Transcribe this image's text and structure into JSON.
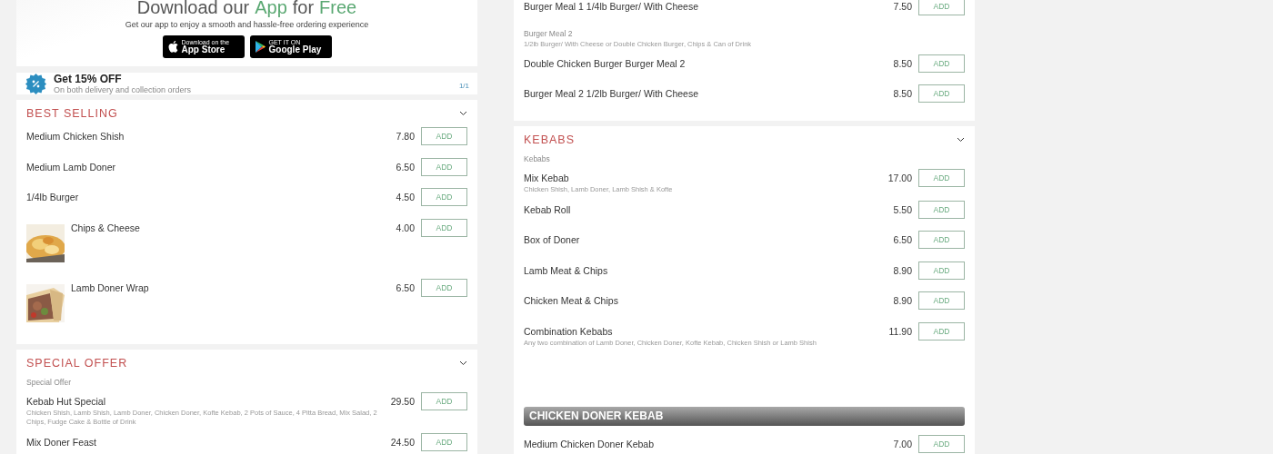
{
  "app_banner": {
    "title": [
      {
        "text": "Download our",
        "highlight": false
      },
      {
        "text": "App",
        "highlight": true
      },
      {
        "text": "for",
        "highlight": false
      },
      {
        "text": "Free",
        "highlight": true
      }
    ],
    "subtitle": "Get our app to enjoy a smooth and hassle-free ordering experience",
    "stores": [
      {
        "kind": "apple",
        "small": "Download on the",
        "big": "App Store"
      },
      {
        "kind": "google",
        "small": "GET IT ON",
        "big": "Google Play"
      }
    ]
  },
  "offer": {
    "title": "Get 15% OFF",
    "subtitle": "On both delivery and collection orders",
    "pager": "1/1"
  },
  "left_sections": [
    {
      "title": "BEST SELLING",
      "entries": [
        {
          "kind": "item",
          "name": "Medium Chicken Shish",
          "price": "7.80",
          "button": "ADD"
        },
        {
          "kind": "item",
          "name": "Medium Lamb Doner",
          "price": "6.50",
          "button": "ADD"
        },
        {
          "kind": "item",
          "name": "1/4lb Burger",
          "price": "4.50",
          "button": "ADD"
        },
        {
          "kind": "picture_item",
          "name": "Chips & Cheese",
          "price": "4.00",
          "button": "ADD"
        },
        {
          "kind": "picture_item",
          "name": "Lamb Doner Wrap",
          "price": "6.50",
          "button": "ADD"
        }
      ]
    },
    {
      "title": "SPECIAL OFFER",
      "entries": [
        {
          "kind": "group_label",
          "name": "Special Offer"
        },
        {
          "kind": "item",
          "name": "Kebab Hut Special",
          "description": "Chicken Shish, Lamb Shish, Lamb Doner, Chicken Doner, Kofte Kebab, 2 Pots of Sauce, 4 Pitta Bread, Mix Salad, 2 Chips, Fudge Cake & Bottle of Drink",
          "price": "29.50",
          "button": "ADD"
        },
        {
          "kind": "item",
          "name": "Mix Doner Feast",
          "price": "24.50",
          "button": "ADD"
        }
      ]
    }
  ],
  "right_sections": [
    {
      "entries": [
        {
          "kind": "item",
          "name": "Burger Meal 1 1/4lb Burger/ With Cheese",
          "price": "7.50",
          "button": "ADD"
        },
        {
          "kind": "group_label",
          "name": "Burger Meal 2",
          "description": "1/2lb Burger/ With Cheese or Double Chicken Burger, Chips & Can of Drink"
        },
        {
          "kind": "item",
          "name": "Double Chicken Burger Burger Meal 2",
          "price": "8.50",
          "button": "ADD"
        },
        {
          "kind": "item",
          "name": "Burger Meal 2 1/2lb Burger/ With Cheese",
          "price": "8.50",
          "button": "ADD"
        }
      ]
    },
    {
      "title": "KEBABS",
      "entries": [
        {
          "kind": "group_label",
          "name": "Kebabs"
        },
        {
          "kind": "item",
          "name": "Mix Kebab",
          "description": "Chicken Shish, Lamb Doner, Lamb Shish & Kofte",
          "price": "17.00",
          "button": "ADD"
        },
        {
          "kind": "item",
          "name": "Kebab Roll",
          "price": "5.50",
          "button": "ADD"
        },
        {
          "kind": "item",
          "name": "Box of Doner",
          "price": "6.50",
          "button": "ADD"
        },
        {
          "kind": "item",
          "name": "Lamb Meat & Chips",
          "price": "8.90",
          "button": "ADD"
        },
        {
          "kind": "item",
          "name": "Chicken Meat & Chips",
          "price": "8.90",
          "button": "ADD"
        },
        {
          "kind": "item",
          "name": "Combination Kebabs",
          "description": "Any two combination of Lamb Doner, Chicken Doner, Kofte Kebab, Chicken Shish or Lamb Shish",
          "price": "11.90",
          "button": "ADD"
        },
        {
          "kind": "banner",
          "name": "CHICKEN DONER KEBAB"
        },
        {
          "kind": "item",
          "name": "Medium Chicken Doner Kebab",
          "price": "7.00",
          "button": "ADD"
        }
      ]
    }
  ]
}
